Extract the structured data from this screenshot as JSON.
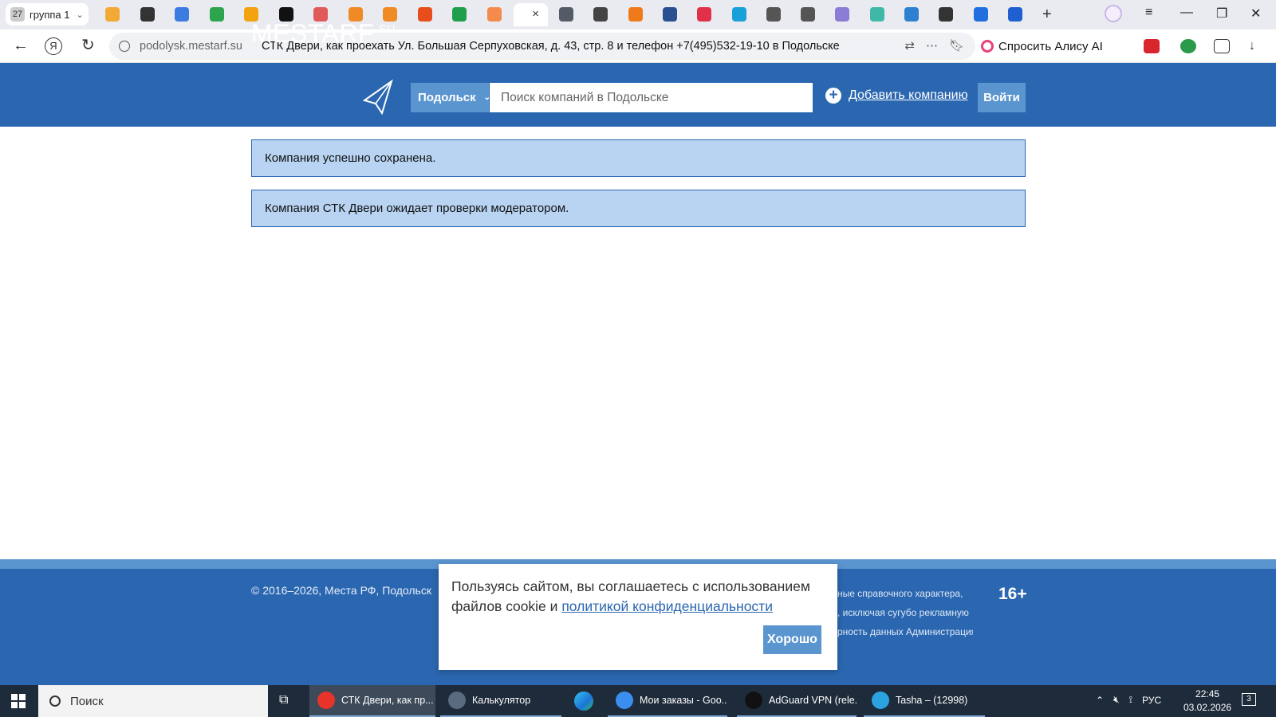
{
  "browser": {
    "tab_group": {
      "count": "27",
      "label": "группа 1"
    },
    "tab_icons": [
      {
        "name": "search-tab-icon",
        "color": "#f3a935"
      },
      {
        "name": "chatgpt-tab-icon",
        "color": "#333333"
      },
      {
        "name": "heart-tab-icon",
        "color": "#3c7be0"
      },
      {
        "name": "google-drive-tab-icon",
        "color": "#2da44e"
      },
      {
        "name": "message-tab-icon",
        "color": "#f2a30f"
      },
      {
        "name": "k-tab-icon",
        "color": "#111111"
      },
      {
        "name": "app-tab-icon",
        "color": "#e05a5a"
      },
      {
        "name": "mail-tab-icon",
        "color": "#f08a24"
      },
      {
        "name": "mail-tab-icon-2",
        "color": "#f08a24"
      },
      {
        "name": "k-orange-tab-icon",
        "color": "#e84d1c"
      },
      {
        "name": "plus-green-tab-icon",
        "color": "#1f9e4b"
      },
      {
        "name": "s-tab-icon",
        "color": "#f48a4c"
      }
    ],
    "tab_icons_right": [
      {
        "name": "chart-tab-icon",
        "color": "#555b66"
      },
      {
        "name": "tablet-tab-icon",
        "color": "#444444"
      },
      {
        "name": "q-tab-icon",
        "color": "#f07a1a"
      },
      {
        "name": "globe-tab-icon",
        "color": "#2a4f91"
      },
      {
        "name": "s-red-tab-icon",
        "color": "#e0304a"
      },
      {
        "name": "skype-tab-icon",
        "color": "#1aa0d8"
      },
      {
        "name": "document-tab-icon",
        "color": "#555555"
      },
      {
        "name": "wallet-tab-icon",
        "color": "#555555"
      },
      {
        "name": "location-tab-icon",
        "color": "#8b7dd6"
      },
      {
        "name": "briefcase-tab-icon",
        "color": "#3fb8a8"
      },
      {
        "name": "info-tab-icon",
        "color": "#2d7fd0"
      },
      {
        "name": "image-tab-icon",
        "color": "#333333"
      },
      {
        "name": "chat-tab-icon",
        "color": "#1f6fe0"
      },
      {
        "name": "mail-blue-tab-icon",
        "color": "#1f5fd0"
      }
    ],
    "active_tab_close": "×",
    "new_tab": "+",
    "url_domain": "podolysk.mestarf.su",
    "page_title": "СТК Двери, как проехать Ул. Большая Серпуховская, д. 43, стр. 8 и телефон +7(495)532-19-10 в Подольске",
    "alice_label": "Спросить Алису AI"
  },
  "site": {
    "logo_main": "MESTA",
    "logo_rf": "RF",
    "logo_su": ".SU",
    "city": "Подольск",
    "search_placeholder": "Поиск компаний в Подольске",
    "add_company": "Добавить компанию",
    "login": "Войти",
    "messages": [
      "Компания успешно сохранена.",
      "Компания СТК Двери ожидает проверки модератором."
    ],
    "footer": {
      "copyright": "© 2016–2026, Места РФ, Подольск",
      "disclaimer_lines": [
        "ные справочного характера,",
        ", исключая сугубо рекламную",
        "рность данных Администрация"
      ],
      "age_rating": "16+"
    },
    "cookie": {
      "text": "Пользуясь сайтом, вы соглашаетесь с использованием файлов cookie и",
      "link": "политикой конфиденциальности",
      "button": "Хорошо"
    }
  },
  "taskbar": {
    "search_label": "Поиск",
    "apps": [
      {
        "label": "СТК Двери, как пр...",
        "icon_color": "#e8332a",
        "active": true
      },
      {
        "label": "Калькулятор",
        "icon_color": "#5a6b80",
        "active": false
      },
      {
        "label": "Мои заказы - Goo...",
        "icon_color": "#3a8ef0",
        "active": false
      },
      {
        "label": "AdGuard VPN (rele...",
        "icon_color": "#111111",
        "active": false
      },
      {
        "label": "Tasha – (12998)",
        "icon_color": "#2aa3e0",
        "active": false
      }
    ],
    "language": "РУС",
    "time": "22:45",
    "date": "03.02.2026",
    "notifications": "3"
  },
  "colors": {
    "brand_blue": "#2b67b0",
    "accent_blue": "#5b95cf",
    "message_bg": "#b8d4f2"
  }
}
